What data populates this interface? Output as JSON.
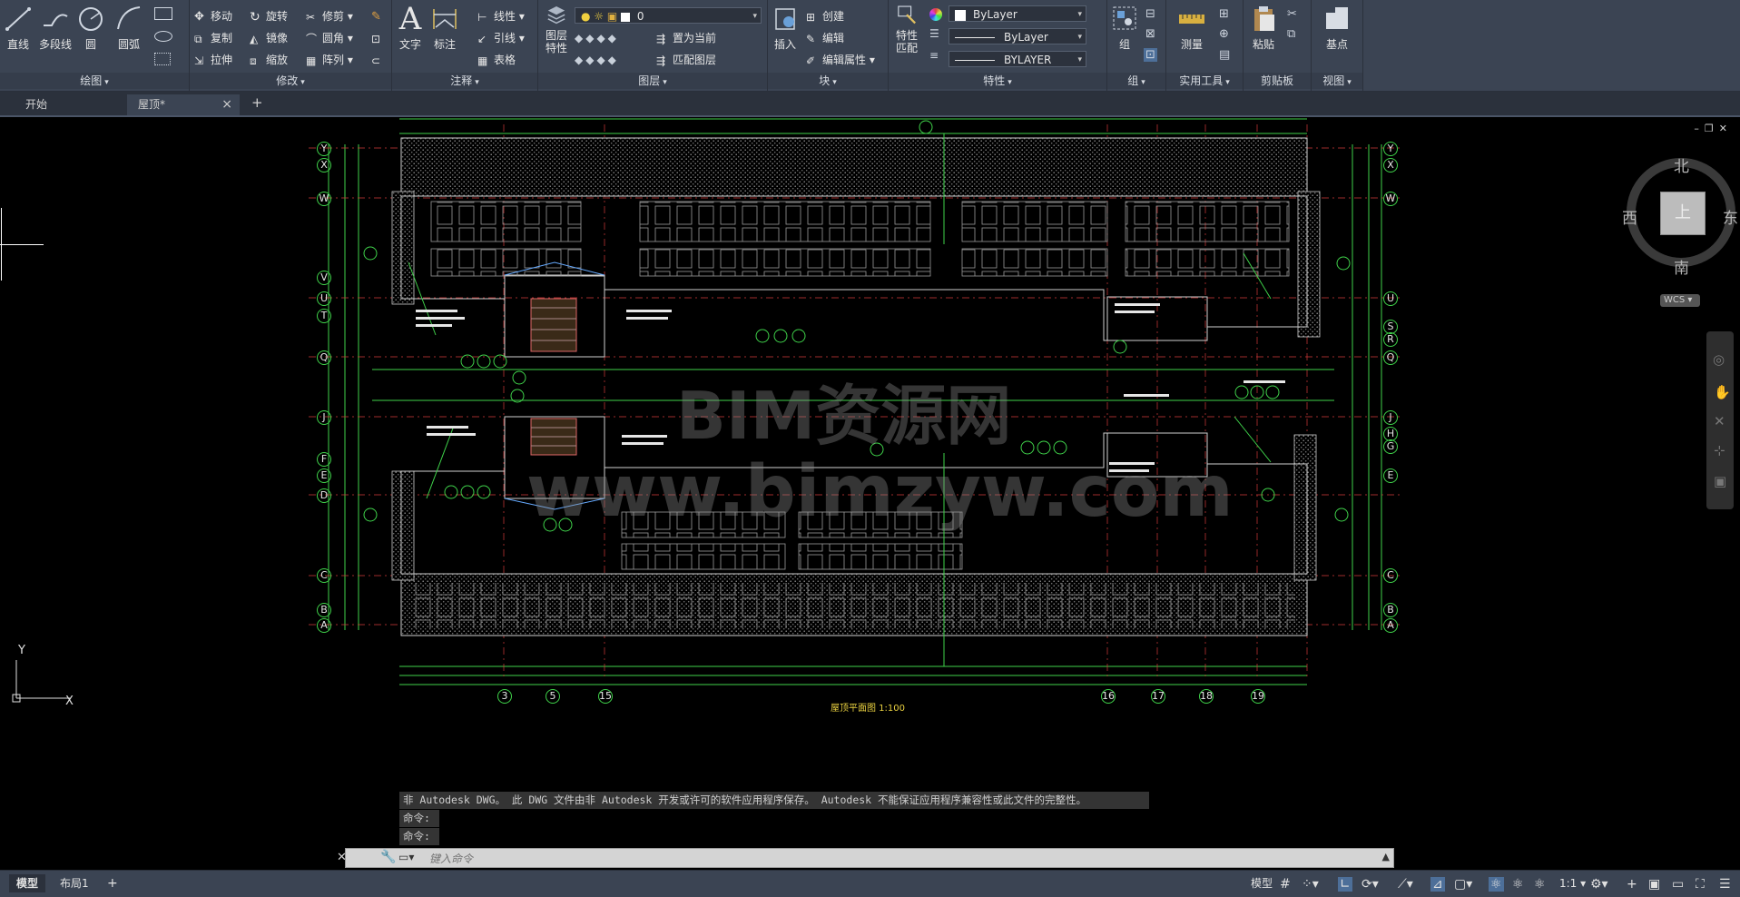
{
  "ribbon": {
    "draw": {
      "title": "绘图",
      "line": "直线",
      "polyline": "多段线",
      "circle": "圆",
      "arc": "圆弧"
    },
    "modify": {
      "title": "修改",
      "move": "移动",
      "rotate": "旋转",
      "trim": "修剪",
      "copy": "复制",
      "mirror": "镜像",
      "fillet": "圆角",
      "stretch": "拉伸",
      "scale": "缩放",
      "array": "阵列"
    },
    "annotation": {
      "title": "注释",
      "text": "文字",
      "dimension": "标注",
      "linear": "线性",
      "leader": "引线",
      "table": "表格"
    },
    "layers": {
      "title": "图层",
      "layer_props_line1": "图层",
      "layer_props_line2": "特性",
      "current_layer": "0",
      "make_current": "置为当前",
      "match_layer": "匹配图层"
    },
    "block": {
      "title": "块",
      "insert": "插入",
      "create": "创建",
      "edit": "编辑",
      "edit_attributes": "编辑属性"
    },
    "properties": {
      "title": "特性",
      "match_line1": "特性",
      "match_line2": "匹配",
      "color": "ByLayer",
      "linetype": "ByLayer",
      "lineweight": "BYLAYER"
    },
    "groups": {
      "title": "组",
      "group": "组"
    },
    "utilities": {
      "title": "实用工具",
      "measure": "测量"
    },
    "clipboard": {
      "title": "剪贴板",
      "paste": "粘贴"
    },
    "view": {
      "title": "视图",
      "base": "基点"
    }
  },
  "tabs": {
    "start": "开始",
    "current": "屋顶*",
    "close": "×",
    "new": "+"
  },
  "viewcube": {
    "north": "北",
    "south": "南",
    "east": "东",
    "west": "西",
    "top": "上",
    "wcs": "WCS"
  },
  "watermark": {
    "line1": "BIM资源网",
    "line2": "www.bimzyw.com"
  },
  "axes": {
    "left_labels": [
      "Y",
      "X",
      "W",
      "V",
      "U",
      "T",
      "Q",
      "J",
      "F",
      "E",
      "D",
      "C",
      "B",
      "A"
    ],
    "right_labels": [
      "Y",
      "X",
      "W",
      "U",
      "S",
      "R",
      "Q",
      "J",
      "H",
      "G",
      "E",
      "C",
      "B",
      "A"
    ],
    "bottom_labels": [
      "3",
      "5",
      "15",
      "16",
      "17",
      "18",
      "19"
    ]
  },
  "drawing_title": "屋顶平面图 1:100",
  "ucs": {
    "x": "X",
    "y": "Y"
  },
  "command": {
    "warning": "非 Autodesk DWG。 此 DWG 文件由非 Autodesk 开发或许可的软件应用程序保存。 Autodesk 不能保证应用程序兼容性或此文件的完整性。",
    "line1": "命令:",
    "line2": "命令:",
    "placeholder": "键入命令"
  },
  "status": {
    "model_tab": "模型",
    "layout_tab": "布局1",
    "add": "+",
    "model_label": "模型",
    "scale": "1:1"
  }
}
